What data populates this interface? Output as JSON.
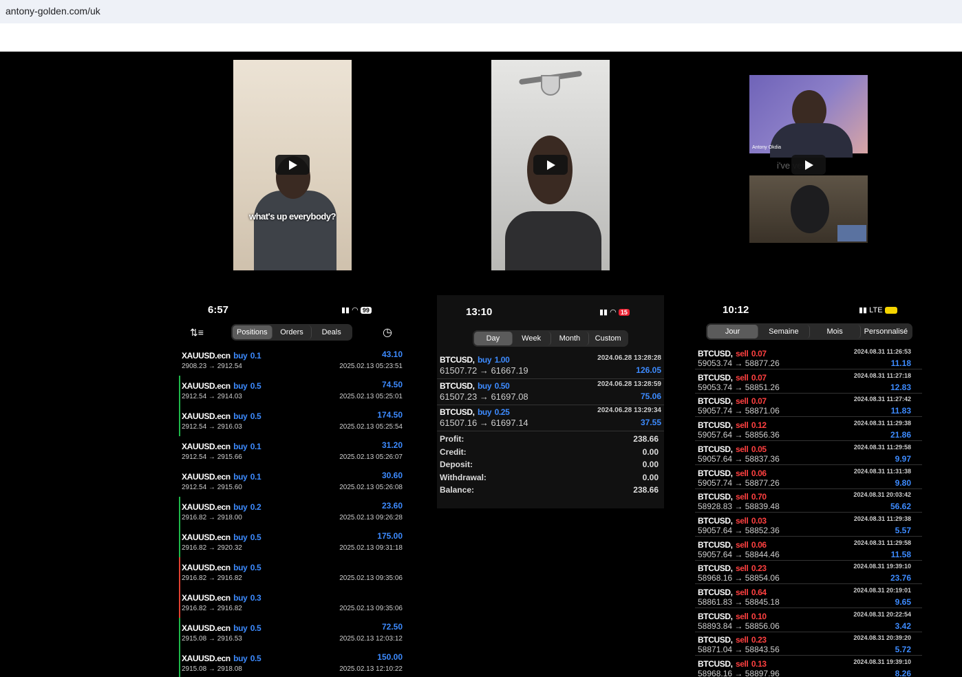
{
  "browser": {
    "url": "antony-golden.com/uk"
  },
  "videos": [
    {
      "caption": "what's up everybody?"
    },
    {
      "caption": ""
    },
    {
      "cam_label": "Antony Okdia",
      "mid_text": "i've          ver"
    }
  ],
  "panel1": {
    "time": "6:57",
    "battery": "99",
    "tabs": [
      "Positions",
      "Orders",
      "Deals"
    ],
    "active_tab": "Positions",
    "rows": [
      {
        "sym": "XAUUSD.ecn",
        "side": "buy",
        "vol": "0.1",
        "profit": "43.10",
        "prices": "2908.23 → 2912.54",
        "dt": "2025.02.13 05:23:51",
        "bar": ""
      },
      {
        "sym": "XAUUSD.ecn",
        "side": "buy",
        "vol": "0.5",
        "profit": "74.50",
        "prices": "2912.54 → 2914.03",
        "dt": "2025.02.13 05:25:01",
        "bar": "#1fb84a"
      },
      {
        "sym": "XAUUSD.ecn",
        "side": "buy",
        "vol": "0.5",
        "profit": "174.50",
        "prices": "2912.54 → 2916.03",
        "dt": "2025.02.13 05:25:54",
        "bar": "#1fb84a"
      },
      {
        "sym": "XAUUSD.ecn",
        "side": "buy",
        "vol": "0.1",
        "profit": "31.20",
        "prices": "2912.54 → 2915.66",
        "dt": "2025.02.13 05:26:07",
        "bar": ""
      },
      {
        "sym": "XAUUSD.ecn",
        "side": "buy",
        "vol": "0.1",
        "profit": "30.60",
        "prices": "2912.54 → 2915.60",
        "dt": "2025.02.13 05:26:08",
        "bar": ""
      },
      {
        "sym": "XAUUSD.ecn",
        "side": "buy",
        "vol": "0.2",
        "profit": "23.60",
        "prices": "2916.82 → 2918.00",
        "dt": "2025.02.13 09:26:28",
        "bar": "#1fb84a"
      },
      {
        "sym": "XAUUSD.ecn",
        "side": "buy",
        "vol": "0.5",
        "profit": "175.00",
        "prices": "2916.82 → 2920.32",
        "dt": "2025.02.13 09:31:18",
        "bar": "#1fb84a"
      },
      {
        "sym": "XAUUSD.ecn",
        "side": "buy",
        "vol": "0.5",
        "profit": "",
        "prices": "2916.82 → 2916.82",
        "dt": "2025.02.13 09:35:06",
        "bar": "#e04030"
      },
      {
        "sym": "XAUUSD.ecn",
        "side": "buy",
        "vol": "0.3",
        "profit": "",
        "prices": "2916.82 → 2916.82",
        "dt": "2025.02.13 09:35:06",
        "bar": "#e04030"
      },
      {
        "sym": "XAUUSD.ecn",
        "side": "buy",
        "vol": "0.5",
        "profit": "72.50",
        "prices": "2915.08 → 2916.53",
        "dt": "2025.02.13 12:03:12",
        "bar": "#1fb84a"
      },
      {
        "sym": "XAUUSD.ecn",
        "side": "buy",
        "vol": "0.5",
        "profit": "150.00",
        "prices": "2915.08 → 2918.08",
        "dt": "2025.02.13 12:10:22",
        "bar": "#1fb84a"
      }
    ]
  },
  "panel2": {
    "time": "13:10",
    "battery": "15",
    "tabs": [
      "Day",
      "Week",
      "Month",
      "Custom"
    ],
    "active_tab": "Day",
    "rows": [
      {
        "sym": "BTCUSD,",
        "side": "buy",
        "vol": "1.00",
        "dt": "2024.06.28 13:28:28",
        "prices": "61507.72 → 61667.19",
        "profit": "126.05"
      },
      {
        "sym": "BTCUSD,",
        "side": "buy",
        "vol": "0.50",
        "dt": "2024.06.28 13:28:59",
        "prices": "61507.23 → 61697.08",
        "profit": "75.06"
      },
      {
        "sym": "BTCUSD,",
        "side": "buy",
        "vol": "0.25",
        "dt": "2024.06.28 13:29:34",
        "prices": "61507.16 → 61697.14",
        "profit": "37.55"
      }
    ],
    "summary": [
      {
        "label": "Profit:",
        "value": "238.66"
      },
      {
        "label": "Credit:",
        "value": "0.00"
      },
      {
        "label": "Deposit:",
        "value": "0.00"
      },
      {
        "label": "Withdrawal:",
        "value": "0.00"
      },
      {
        "label": "Balance:",
        "value": "238.66"
      }
    ]
  },
  "panel3": {
    "time": "10:12",
    "network": "LTE",
    "tabs": [
      "Jour",
      "Semaine",
      "Mois",
      "Personnalisé"
    ],
    "active_tab": "Jour",
    "rows": [
      {
        "sym": "BTCUSD,",
        "side": "sell",
        "vol": "0.07",
        "dt": "2024.08.31 11:26:53",
        "prices": "59053.74 → 58877.26",
        "profit": "11.18"
      },
      {
        "sym": "BTCUSD,",
        "side": "sell",
        "vol": "0.07",
        "dt": "2024.08.31 11:27:18",
        "prices": "59053.74 → 58851.26",
        "profit": "12.83"
      },
      {
        "sym": "BTCUSD,",
        "side": "sell",
        "vol": "0.07",
        "dt": "2024.08.31 11:27:42",
        "prices": "59057.74 → 58871.06",
        "profit": "11.83"
      },
      {
        "sym": "BTCUSD,",
        "side": "sell",
        "vol": "0.12",
        "dt": "2024.08.31 11:29:38",
        "prices": "59057.64 → 58856.36",
        "profit": "21.86"
      },
      {
        "sym": "BTCUSD,",
        "side": "sell",
        "vol": "0.05",
        "dt": "2024.08.31 11:29:58",
        "prices": "59057.64 → 58837.36",
        "profit": "9.97"
      },
      {
        "sym": "BTCUSD,",
        "side": "sell",
        "vol": "0.06",
        "dt": "2024.08.31 11:31:38",
        "prices": "59057.74 → 58877.26",
        "profit": "9.80"
      },
      {
        "sym": "BTCUSD,",
        "side": "sell",
        "vol": "0.70",
        "dt": "2024.08.31 20:03:42",
        "prices": "58928.83 → 58839.48",
        "profit": "56.62"
      },
      {
        "sym": "BTCUSD,",
        "side": "sell",
        "vol": "0.03",
        "dt": "2024.08.31 11:29:38",
        "prices": "59057.64 → 58852.36",
        "profit": "5.57"
      },
      {
        "sym": "BTCUSD,",
        "side": "sell",
        "vol": "0.06",
        "dt": "2024.08.31 11:29:58",
        "prices": "59057.64 → 58844.46",
        "profit": "11.58"
      },
      {
        "sym": "BTCUSD,",
        "side": "sell",
        "vol": "0.23",
        "dt": "2024.08.31 19:39:10",
        "prices": "58968.16 → 58854.06",
        "profit": "23.76"
      },
      {
        "sym": "BTCUSD,",
        "side": "sell",
        "vol": "0.64",
        "dt": "2024.08.31 20:19:01",
        "prices": "58861.83 → 58845.18",
        "profit": "9.65"
      },
      {
        "sym": "BTCUSD,",
        "side": "sell",
        "vol": "0.10",
        "dt": "2024.08.31 20:22:54",
        "prices": "58893.84 → 58856.06",
        "profit": "3.42"
      },
      {
        "sym": "BTCUSD,",
        "side": "sell",
        "vol": "0.23",
        "dt": "2024.08.31 20:39:20",
        "prices": "58871.04 → 58843.56",
        "profit": "5.72"
      },
      {
        "sym": "BTCUSD,",
        "side": "sell",
        "vol": "0.13",
        "dt": "2024.08.31 19:39:10",
        "prices": "58968.16 → 58897.96",
        "profit": "8.26"
      }
    ]
  }
}
